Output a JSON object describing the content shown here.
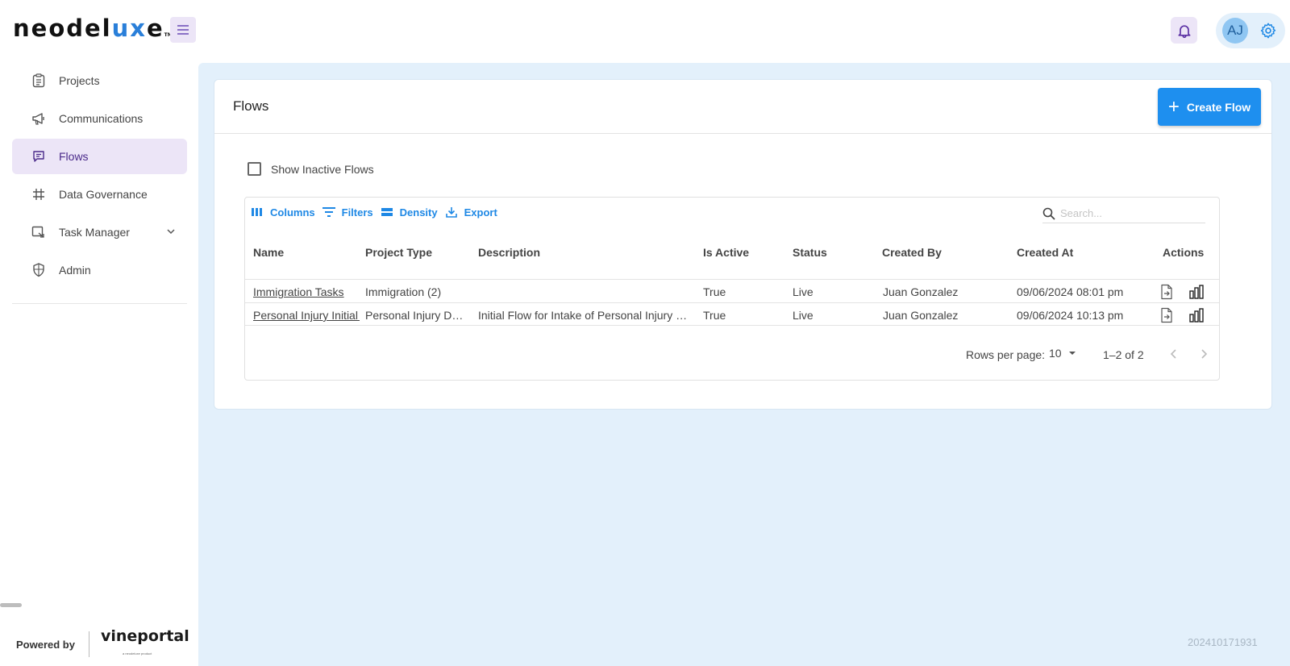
{
  "app": {
    "logo_pre": "neodel",
    "logo_ux": "ux",
    "logo_post": "e",
    "logo_tm": "TM"
  },
  "header": {
    "avatar_initials": "AJ"
  },
  "sidebar": {
    "items": [
      {
        "label": "Projects",
        "icon": "clipboard-icon"
      },
      {
        "label": "Communications",
        "icon": "megaphone-icon"
      },
      {
        "label": "Flows",
        "icon": "message-square-icon",
        "active": true
      },
      {
        "label": "Data Governance",
        "icon": "grid-icon"
      },
      {
        "label": "Task Manager",
        "icon": "task-icon",
        "expandable": true
      },
      {
        "label": "Admin",
        "icon": "shield-icon"
      }
    ],
    "powered_by": "Powered by",
    "brand": "vineportal",
    "brand_sub": "a neodeluxe product"
  },
  "page": {
    "title": "Flows",
    "create_button": "Create Flow",
    "show_inactive_label": "Show Inactive Flows",
    "build_id": "202410171931"
  },
  "grid": {
    "toolbar": {
      "columns": "Columns",
      "filters": "Filters",
      "density": "Density",
      "export": "Export"
    },
    "search_placeholder": "Search...",
    "headers": {
      "name": "Name",
      "project_type": "Project Type",
      "description": "Description",
      "is_active": "Is Active",
      "status": "Status",
      "created_by": "Created By",
      "created_at": "Created At",
      "actions": "Actions"
    },
    "rows": [
      {
        "name": "Immigration Tasks",
        "project_type": "Immigration (2)",
        "description": "",
        "is_active": "True",
        "status": "Live",
        "created_by": "Juan Gonzalez",
        "created_at": "09/06/2024 08:01 pm"
      },
      {
        "name": "Personal Injury Initial Intake",
        "project_type": "Personal Injury Demo",
        "description": "Initial Flow for Intake of Personal Injury Clients",
        "is_active": "True",
        "status": "Live",
        "created_by": "Juan Gonzalez",
        "created_at": "09/06/2024 10:13 pm"
      }
    ],
    "footer": {
      "rows_per_page_label": "Rows per page:",
      "rows_per_page_value": "10",
      "range": "1–2 of 2"
    }
  },
  "colors": {
    "accent": "#1e8fef",
    "nav_active_bg": "#ece5f7",
    "main_bg": "#e3f0fb"
  }
}
